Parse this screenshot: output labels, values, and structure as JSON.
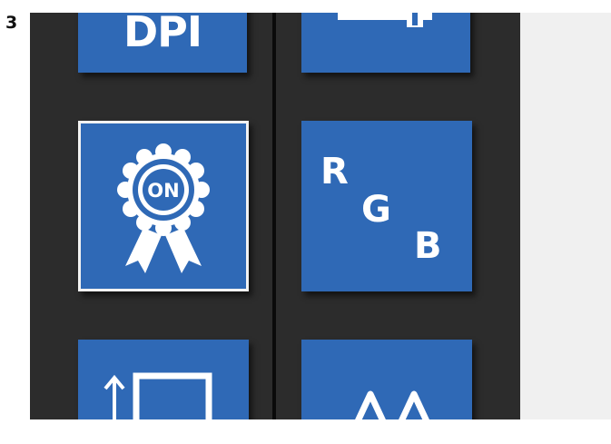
{
  "step_label": "3",
  "tiles": {
    "dpi": {
      "label": "DPI",
      "icon": "dpi-icon"
    },
    "slider": {
      "icon": "slider-icon"
    },
    "badge": {
      "label": "ON",
      "icon": "on-badge-icon",
      "selected": true
    },
    "rgb": {
      "letters": [
        "R",
        "G",
        "B"
      ],
      "icon": "rgb-icon"
    },
    "resize": {
      "icon": "vertical-resize-icon"
    },
    "wave": {
      "icon": "waveform-icon"
    }
  },
  "colors": {
    "tile_blue": "#2f69b6",
    "panel_dark": "#2c2c2c",
    "divider": "#0a0a0a",
    "side_background": "#f0f0f0"
  }
}
